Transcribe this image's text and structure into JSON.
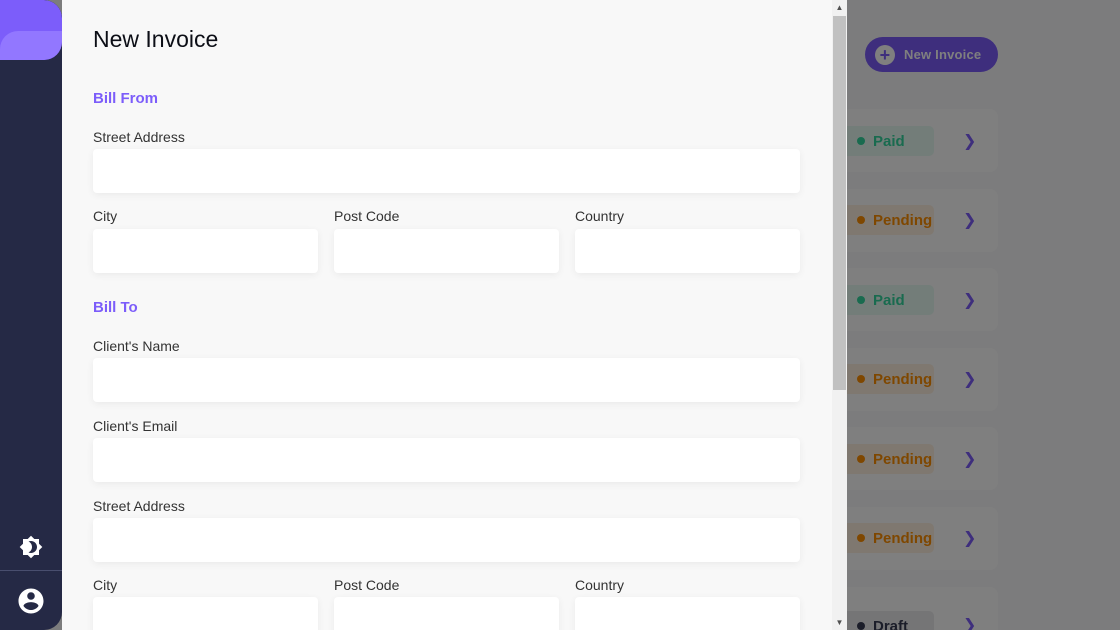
{
  "background": {
    "new_invoice_label": "New Invoice",
    "invoices": [
      {
        "status": "Paid",
        "kind": "paid"
      },
      {
        "status": "Pending",
        "kind": "pending"
      },
      {
        "status": "Paid",
        "kind": "paid"
      },
      {
        "status": "Pending",
        "kind": "pending"
      },
      {
        "status": "Pending",
        "kind": "pending"
      },
      {
        "status": "Pending",
        "kind": "pending"
      },
      {
        "status": "Draft",
        "kind": "draft"
      }
    ]
  },
  "sidebar": {
    "logo_icon": "logo-icon",
    "theme_icon": "theme-toggle-icon",
    "avatar_icon": "account-circle-icon"
  },
  "drawer": {
    "title": "New Invoice",
    "bill_from": {
      "section_label": "Bill From",
      "street_label": "Street Address",
      "city_label": "City",
      "post_code_label": "Post Code",
      "country_label": "Country"
    },
    "bill_to": {
      "section_label": "Bill To",
      "client_name_label": "Client's Name",
      "client_email_label": "Client's Email",
      "street_label": "Street Address",
      "city_label": "City",
      "post_code_label": "Post Code",
      "country_label": "Country"
    }
  },
  "colors": {
    "accent": "#7c5dfa",
    "sidebar": "#252945",
    "paid": "#33d69f",
    "pending": "#ff8f00",
    "draft": "#373b53"
  }
}
